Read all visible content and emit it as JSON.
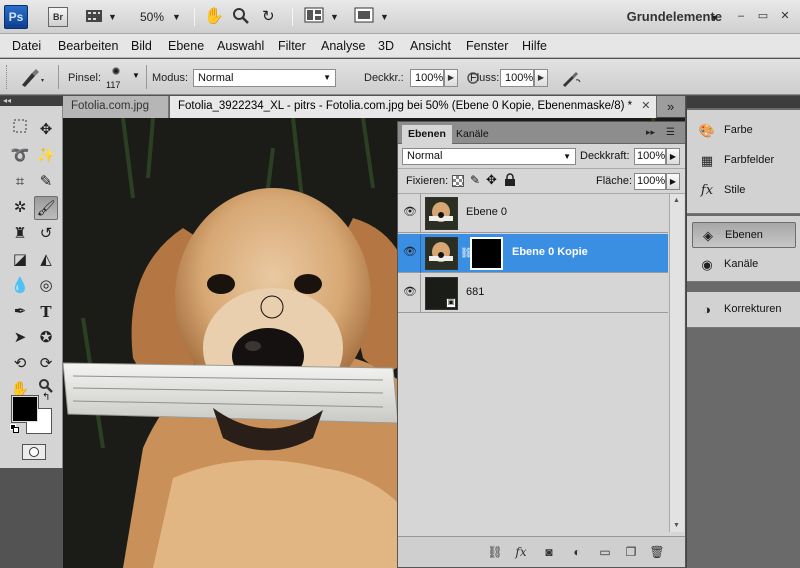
{
  "appbar": {
    "logo": "Ps",
    "bridge_label": "Br",
    "zoom": "50%",
    "workspace": "Grundelemente",
    "window_controls": [
      "–",
      "▭",
      "✕"
    ]
  },
  "menu": [
    "Datei",
    "Bearbeiten",
    "Bild",
    "Ebene",
    "Auswahl",
    "Filter",
    "Analyse",
    "3D",
    "Ansicht",
    "Fenster",
    "Hilfe"
  ],
  "options": {
    "brush_label": "Pinsel:",
    "brush_size": "117",
    "mode_label": "Modus:",
    "mode_value": "Normal",
    "opacity_label": "Deckkr.:",
    "opacity_value": "100%",
    "flow_label": "Fluss:",
    "flow_value": "100%"
  },
  "tabs": {
    "inactive": "Fotolia.com.jpg",
    "active": "Fotolia_3922234_XL - pitrs - Fotolia.com.jpg bei 50% (Ebene 0 Kopie, Ebenenmaske/8) *",
    "close": "✕",
    "overflow": "»"
  },
  "layers_panel": {
    "tabs": [
      "Ebenen",
      "Kanäle"
    ],
    "blend_mode": "Normal",
    "opacity_label": "Deckkraft:",
    "opacity_value": "100%",
    "lock_label": "Fixieren:",
    "fill_label": "Fläche:",
    "fill_value": "100%",
    "layers": [
      {
        "name": "Ebene 0",
        "selected": false
      },
      {
        "name": "Ebene 0 Kopie",
        "selected": true
      },
      {
        "name": "681",
        "selected": false
      }
    ]
  },
  "dock": {
    "group1": [
      {
        "label": "Farbe",
        "icon": "color-icon"
      },
      {
        "label": "Farbfelder",
        "icon": "swatches-icon"
      },
      {
        "label": "Stile",
        "icon": "styles-icon"
      }
    ],
    "group2": [
      {
        "label": "Ebenen",
        "icon": "layers-icon",
        "active": true
      },
      {
        "label": "Kanäle",
        "icon": "channels-icon"
      }
    ],
    "group3": [
      {
        "label": "Korrekturen",
        "icon": "adjustments-icon"
      }
    ]
  },
  "colors": {
    "selection_blue": "#3a8fe2",
    "foreground": "#000000",
    "background": "#ffffff"
  }
}
